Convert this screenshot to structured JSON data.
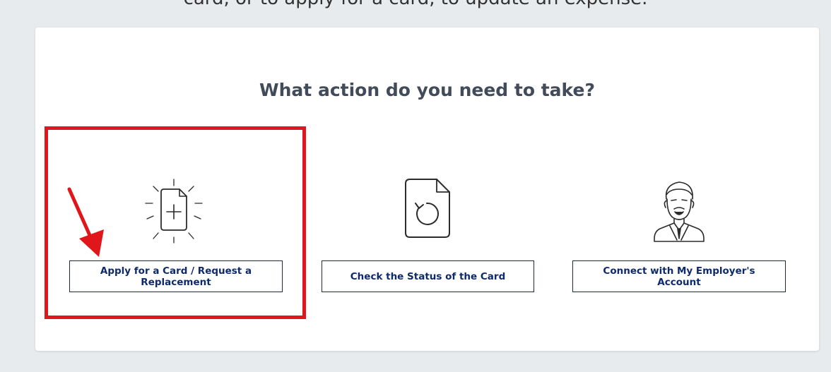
{
  "header": {
    "top_text": "card, or to apply for a card, to update an expense."
  },
  "main": {
    "title": "What action do you need to take?",
    "actions": [
      {
        "label": "Apply for a Card / Request a Replacement",
        "icon": "new-document-icon"
      },
      {
        "label": "Check the Status of the Card",
        "icon": "document-refresh-icon"
      },
      {
        "label": "Connect with My Employer's Account",
        "icon": "employer-avatar-icon"
      }
    ]
  },
  "annotation": {
    "highlight_color": "#e0161a",
    "highlighted_action": "Apply for a Card / Request a Replacement"
  }
}
